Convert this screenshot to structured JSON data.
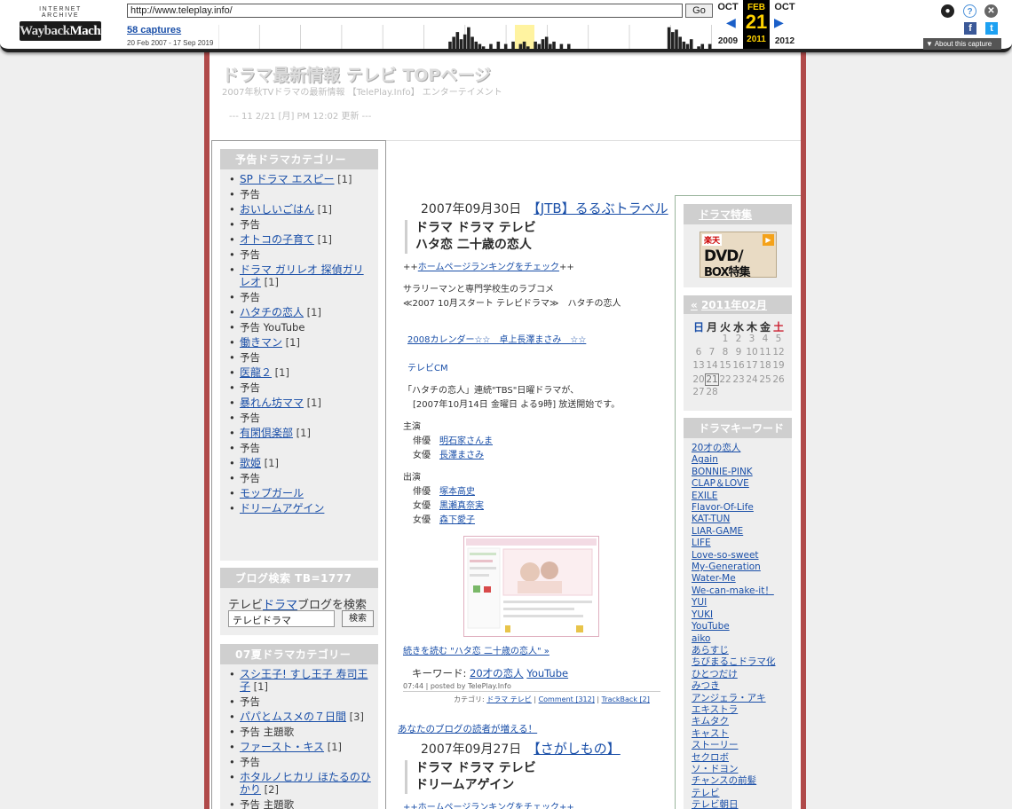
{
  "wayback": {
    "logo_small": "INTERNET ARCHIVE",
    "logo_a": "Wayback",
    "logo_b": "Machine",
    "url": "http://www.teleplay.info/",
    "go": "Go",
    "captures": "58 captures",
    "range": "20 Feb 2007 - 17 Sep 2019",
    "prev_month": "OCT",
    "cur_month": "FEB",
    "next_month": "OCT",
    "day": "21",
    "prev_year": "2009",
    "cur_year": "2011",
    "next_year": "2012",
    "about": "▼ About this capture",
    "sparkline": [
      0,
      0,
      0,
      0,
      0,
      0,
      0,
      0,
      0,
      0,
      0,
      0,
      0,
      0,
      0,
      0,
      0,
      0,
      0,
      0,
      0,
      0,
      0,
      0,
      0,
      0,
      0,
      0,
      0,
      0,
      0,
      0,
      0,
      0,
      0,
      0,
      0,
      0,
      0,
      0,
      0,
      0,
      0,
      0,
      0,
      0,
      0,
      0,
      0,
      0,
      0,
      0,
      0,
      0,
      0,
      0,
      0,
      0,
      0,
      0,
      0,
      0,
      3,
      5,
      7,
      4,
      6,
      9,
      5,
      3,
      2,
      1,
      0,
      2,
      0,
      3,
      0,
      2,
      0,
      3,
      0,
      2,
      3,
      1,
      0,
      3,
      2,
      4,
      5,
      2,
      3,
      0,
      2,
      0,
      2,
      0,
      0,
      0,
      0,
      0,
      0,
      0,
      0,
      0,
      0,
      0,
      0,
      0,
      0,
      0,
      0,
      0,
      0,
      0,
      0,
      0,
      0,
      0,
      0,
      0,
      0,
      9,
      7,
      8,
      5,
      3,
      2,
      4,
      0,
      1,
      2,
      0,
      2
    ]
  },
  "site": {
    "title": "ドラマ最新情報 テレビ TOPページ",
    "subtitle": "2007年秋TVドラマの最新情報 【TelePlay.Info】 エンターテイメント",
    "updated": "--- 11 2/21 [月] PM 12:02 更新 ---"
  },
  "left": {
    "box1_title": "予告ドラマカテゴリー",
    "box1_items": [
      {
        "link": "SP ドラマ エスピー",
        "count": "[1]",
        "sub": "予告"
      },
      {
        "link": "おいしいごはん",
        "count": "[1]",
        "sub": "予告"
      },
      {
        "link": "オトコの子育て",
        "count": "[1]",
        "sub": "予告"
      },
      {
        "link": "ドラマ ガリレオ 探偵ガリレオ",
        "count": "[1]",
        "sub": "予告"
      },
      {
        "link": "ハタチの恋人",
        "count": "[1]",
        "sub": "予告 YouTube"
      },
      {
        "link": "働きマン",
        "count": "[1]",
        "sub": "予告"
      },
      {
        "link": "医龍２",
        "count": "[1]",
        "sub": "予告"
      },
      {
        "link": "暴れん坊ママ",
        "count": "[1]",
        "sub": "予告"
      },
      {
        "link": "有閑倶楽部",
        "count": "[1]",
        "sub": "予告"
      },
      {
        "link": "歌姫",
        "count": "[1]",
        "sub": "予告"
      },
      {
        "link": "モップガール",
        "count": "",
        "sub": ""
      },
      {
        "link": "ドリームアゲイン",
        "count": "",
        "sub": ""
      }
    ],
    "search_title": "ブログ検索 TB=1777",
    "search_label_a": "テレビ",
    "search_label_link": "ドラマ",
    "search_label_b": "ブログを検索",
    "search_value": "テレビドラマ",
    "search_button": "検索",
    "box3_title": "07夏ドラマカテゴリー",
    "box3_items": [
      {
        "link": "スシ王子! すし王子 寿司王子",
        "count": "[1]",
        "sub": "予告"
      },
      {
        "link": "パパとムスメの７日間",
        "count": "[3]",
        "sub": "予告 主題歌"
      },
      {
        "link": "ファースト・キス",
        "count": "[1]",
        "sub": "予告"
      },
      {
        "link": "ホタルノヒカリ ほたるのひかり",
        "count": "[2]",
        "sub": "予告 主題歌"
      }
    ]
  },
  "entry1": {
    "date": "2007年09月30日",
    "date_link": "【JTB】るるぶトラベル",
    "title1": "ドラマ ドラマ テレビ",
    "title2": "ハタ恋 二十歳の恋人",
    "rank_pre": "++",
    "rank_link": "ホームページランキングをチェック",
    "rank_post": "++",
    "line1": "サラリーマンと専門学校生のラブコメ",
    "line2": "≪2007 10月スタート テレビドラマ≫　ハタチの恋人",
    "cal_link": "2008カレンダー☆☆　卓上長澤まさみ　☆☆",
    "cm": "テレビCM",
    "desc1": "「ハタチの恋人」連続\"TBS\"日曜ドラマが、",
    "desc2": "[2007年10月14日 金曜日 よる9時] 放送開始です。",
    "cast_main": "主演",
    "cast_main_rows": [
      {
        "role": "俳優",
        "name": "明石家さんま"
      },
      {
        "role": "女優",
        "name": "長澤まさみ"
      }
    ],
    "cast_sub": "出演",
    "cast_sub_rows": [
      {
        "role": "俳優",
        "name": "塚本高史"
      },
      {
        "role": "女優",
        "name": "黒瀬真奈実"
      },
      {
        "role": "女優",
        "name": "森下愛子"
      }
    ],
    "more": "続きを読む \"ハタ恋 二十歳の恋人\" »",
    "kw_label": "キーワード:",
    "kw1": "20才の恋人",
    "kw2": "YouTube",
    "posted": "07:44 | posted by TelePlay.Info",
    "cat_label": "カテゴリ:",
    "cat_link": "ドラマ テレビ",
    "comment": "Comment [312]",
    "trackback": "TrackBack [2]",
    "readers": "あなたのブログの読者が増える！"
  },
  "entry2": {
    "date": "2007年09月27日",
    "date_link": "【さがしもの】",
    "title1": "ドラマ ドラマ テレビ",
    "title2": "ドリームアゲイン",
    "rank_partial": "++ホームページランキングをチェック++"
  },
  "right": {
    "feature_title": "ドラマ特集",
    "banner_top": "楽天",
    "banner_mid": "DVD/",
    "banner_bot": "BOX特集",
    "cal_nav": "«",
    "cal_title": "2011年02月",
    "dow": [
      "日",
      "月",
      "火",
      "水",
      "木",
      "金",
      "土"
    ],
    "cal_rows": [
      [
        "",
        "",
        "1",
        "2",
        "3",
        "4",
        "5"
      ],
      [
        "6",
        "7",
        "8",
        "9",
        "10",
        "11",
        "12"
      ],
      [
        "13",
        "14",
        "15",
        "16",
        "17",
        "18",
        "19"
      ],
      [
        "20",
        "21",
        "22",
        "23",
        "24",
        "25",
        "26"
      ],
      [
        "27",
        "28",
        "",
        "",
        "",
        "",
        ""
      ]
    ],
    "today": "21",
    "kw_title": "ドラマキーワード",
    "keywords": [
      "20才の恋人",
      "Again",
      "BONNIE-PINK",
      "CLAP＆LOVE",
      "EXILE",
      "Flavor-Of-Life",
      "KAT-TUN",
      "LIAR-GAME",
      "LIFE",
      "Love-so-sweet",
      "My-Generation",
      "Water-Me",
      "We-can-make-it！",
      "YUI",
      "YUKI",
      "YouTube",
      "aiko",
      "あらすじ",
      "ちびまるこドラマ化",
      "ひとつだけ",
      "みつき",
      "アンジェラ・アキ",
      "エキストラ",
      "キムタク",
      "キャスト",
      "ストーリー",
      "セクロボ",
      "ソ・ドヨン",
      "チャンスの前髪",
      "テレビ",
      "テレビ朝日"
    ]
  }
}
